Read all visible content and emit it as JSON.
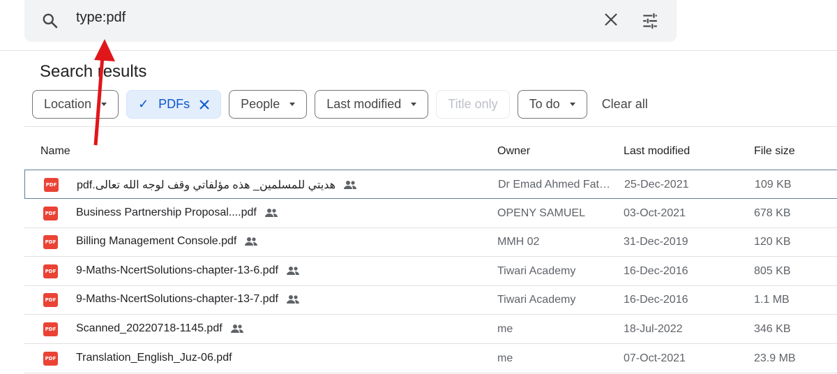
{
  "search": {
    "query": "type:pdf"
  },
  "title": "Search results",
  "filters": [
    {
      "label": "Location",
      "type": "dropdown"
    },
    {
      "label": "PDFs",
      "type": "active"
    },
    {
      "label": "People",
      "type": "dropdown"
    },
    {
      "label": "Last modified",
      "type": "dropdown"
    },
    {
      "label": "Title only",
      "type": "disabled"
    },
    {
      "label": "To do",
      "type": "dropdown"
    }
  ],
  "clear_all": "Clear all",
  "columns": {
    "name": "Name",
    "owner": "Owner",
    "modified": "Last modified",
    "size": "File size"
  },
  "files": [
    {
      "name": "هديتي للمسلمين_ هذه مؤلفاتي وقف لوجه الله تعالى.pdf",
      "owner": "Dr Emad Ahmed Fat…",
      "modified": "25-Dec-2021",
      "size": "109 KB",
      "shared": true
    },
    {
      "name": "Business Partnership Proposal....pdf",
      "owner": "OPENY SAMUEL",
      "modified": "03-Oct-2021",
      "size": "678 KB",
      "shared": true
    },
    {
      "name": "Billing Management Console.pdf",
      "owner": "MMH 02",
      "modified": "31-Dec-2019",
      "size": "120 KB",
      "shared": true
    },
    {
      "name": "9-Maths-NcertSolutions-chapter-13-6.pdf",
      "owner": "Tiwari Academy",
      "modified": "16-Dec-2016",
      "size": "805 KB",
      "shared": true
    },
    {
      "name": "9-Maths-NcertSolutions-chapter-13-7.pdf",
      "owner": "Tiwari Academy",
      "modified": "16-Dec-2016",
      "size": "1.1 MB",
      "shared": true
    },
    {
      "name": "Scanned_20220718-1145.pdf",
      "owner": "me",
      "modified": "18-Jul-2022",
      "size": "346 KB",
      "shared": true
    },
    {
      "name": "Translation_English_Juz-06.pdf",
      "owner": "me",
      "modified": "07-Oct-2021",
      "size": "23.9 MB",
      "shared": false
    }
  ],
  "pdf_icon_label": "PDF",
  "colors": {
    "accent": "#0b57d0",
    "pdf": "#ea4335",
    "annotation_arrow": "#e0161b"
  }
}
